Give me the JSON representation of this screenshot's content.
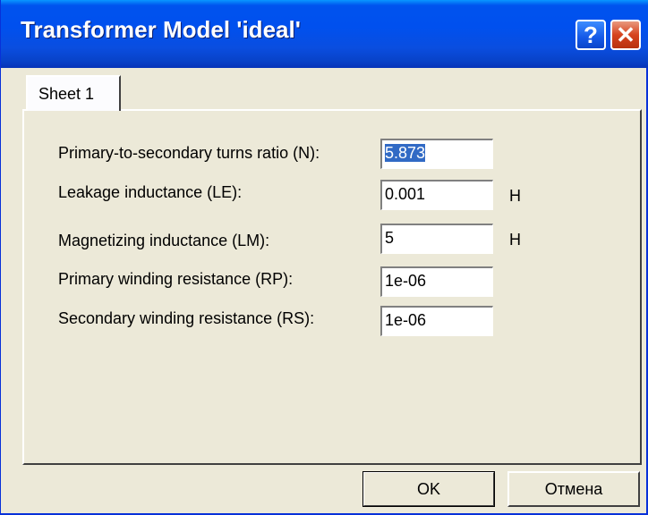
{
  "window": {
    "title": "Transformer Model 'ideal'",
    "help_label": "?",
    "close_label": "✕"
  },
  "tab": {
    "label": "Sheet 1"
  },
  "fields": [
    {
      "label": "Primary-to-secondary turns ratio (N):",
      "value": "5.873",
      "unit": "",
      "selected": true
    },
    {
      "label": "Leakage inductance (LE):",
      "value": "0.001",
      "unit": "H"
    },
    {
      "label": "Magnetizing inductance (LM):",
      "value": "5",
      "unit": "H"
    },
    {
      "label": "Primary winding resistance (RP):",
      "value": "1e-06",
      "unit": ""
    },
    {
      "label": "Secondary winding resistance (RS):",
      "value": "1e-06",
      "unit": ""
    }
  ],
  "buttons": {
    "ok": "OK",
    "cancel": "Отмена"
  }
}
